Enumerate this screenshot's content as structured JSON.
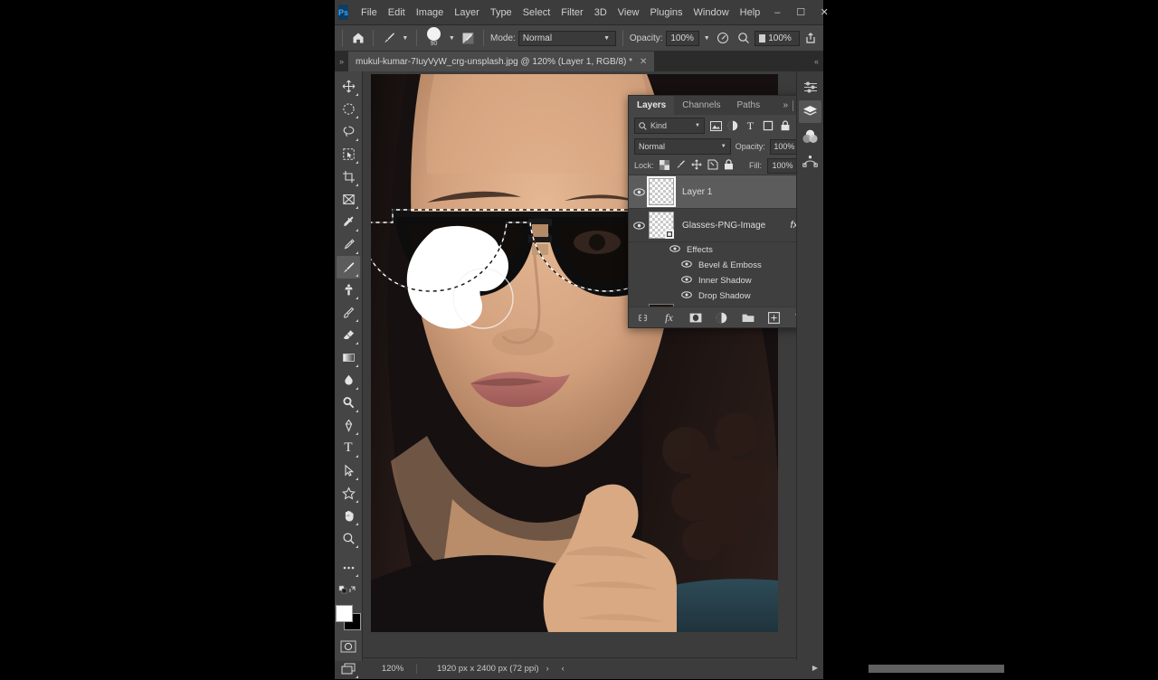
{
  "app": {
    "name": "Adobe Photoshop",
    "logo_text": "Ps"
  },
  "menubar": {
    "items": [
      "File",
      "Edit",
      "Image",
      "Layer",
      "Type",
      "Select",
      "Filter",
      "3D",
      "View",
      "Plugins",
      "Window",
      "Help"
    ],
    "window_controls": [
      "minimize",
      "maximize",
      "close"
    ]
  },
  "options_bar": {
    "home_icon": "home-icon",
    "brush_tool_icon": "brush-icon",
    "brush_size": "90",
    "brush_settings_icon": "brush-panel-icon",
    "mode_label": "Mode:",
    "mode_value": "Normal",
    "opacity_label": "Opacity:",
    "opacity_value": "100%",
    "airbrush_icon": "airbrush-icon",
    "flow_icon": "flow-icon",
    "smoothing_value": "100%",
    "share_icon": "share-icon"
  },
  "tab_bar": {
    "expand_icon": "chevron-double-right-icon",
    "collapse_icon": "chevron-double-left-icon",
    "document_title": "mukul-kumar-7IuyVyW_crg-unsplash.jpg @ 120% (Layer 1, RGB/8) *",
    "close_icon": "close-icon"
  },
  "toolbar": {
    "tools": [
      {
        "name": "move-tool",
        "selected": false
      },
      {
        "name": "marquee-tool",
        "selected": false
      },
      {
        "name": "lasso-tool",
        "selected": false
      },
      {
        "name": "quick-selection-tool",
        "selected": false
      },
      {
        "name": "crop-tool",
        "selected": false
      },
      {
        "name": "frame-tool",
        "selected": false
      },
      {
        "name": "eyedropper-tool",
        "selected": false
      },
      {
        "name": "healing-brush-tool",
        "selected": false
      },
      {
        "name": "brush-tool",
        "selected": true
      },
      {
        "name": "clone-stamp-tool",
        "selected": false
      },
      {
        "name": "history-brush-tool",
        "selected": false
      },
      {
        "name": "eraser-tool",
        "selected": false
      },
      {
        "name": "gradient-tool",
        "selected": false
      },
      {
        "name": "blur-tool",
        "selected": false
      },
      {
        "name": "dodge-tool",
        "selected": false
      },
      {
        "name": "pen-tool",
        "selected": false
      },
      {
        "name": "type-tool",
        "selected": false
      },
      {
        "name": "path-selection-tool",
        "selected": false
      },
      {
        "name": "shape-tool",
        "selected": false
      },
      {
        "name": "hand-tool",
        "selected": false
      },
      {
        "name": "zoom-tool",
        "selected": false
      },
      {
        "name": "edit-toolbar-tool",
        "selected": false
      }
    ],
    "foreground_color": "#ffffff",
    "background_color": "#000000",
    "quick_mask_icon": "quick-mask-icon",
    "screen_mode_icon": "screen-mode-icon"
  },
  "layers_panel": {
    "tabs": [
      {
        "label": "Layers",
        "active": true
      },
      {
        "label": "Channels",
        "active": false
      },
      {
        "label": "Paths",
        "active": false
      }
    ],
    "panel_menu_icon": "panel-menu-icon",
    "filter": {
      "search_icon": "search-icon",
      "kind_label": "Kind",
      "filter_icons": [
        "pixel-filter-icon",
        "adjustment-filter-icon",
        "type-filter-icon",
        "shape-filter-icon",
        "smart-object-filter-icon"
      ],
      "toggle_icon": "filter-toggle-icon"
    },
    "blend_mode": "Normal",
    "opacity_label": "Opacity:",
    "opacity_value": "100%",
    "lock_label": "Lock:",
    "lock_icons": [
      "lock-transparent-icon",
      "lock-image-icon",
      "lock-position-icon",
      "lock-artboard-icon",
      "lock-all-icon"
    ],
    "fill_label": "Fill:",
    "fill_value": "100%",
    "layers": [
      {
        "name": "Layer 1",
        "visible": true,
        "selected": true,
        "has_effects": false,
        "thumb": "transparent"
      },
      {
        "name": "Glasses-PNG-Image",
        "visible": true,
        "selected": false,
        "has_effects": true,
        "fx_label": "fx",
        "thumb": "transparent",
        "effects_group": "Effects",
        "effects": [
          "Bevel & Emboss",
          "Inner Shadow",
          "Drop Shadow"
        ]
      },
      {
        "name": "",
        "visible": true,
        "selected": false,
        "has_effects": false,
        "thumb": "photo"
      }
    ],
    "footer_buttons": [
      "link-layers-icon",
      "layer-style-icon",
      "layer-mask-icon",
      "adjustment-layer-icon",
      "new-group-icon",
      "new-layer-icon",
      "delete-layer-icon"
    ]
  },
  "right_dock": {
    "items": [
      {
        "name": "adjustments-panel-icon",
        "active": false
      },
      {
        "name": "layers-panel-icon",
        "active": true
      },
      {
        "name": "color-panel-icon",
        "active": false
      },
      {
        "name": "paths-panel-icon",
        "active": false
      }
    ]
  },
  "status_bar": {
    "zoom": "120%",
    "document_size": "1920 px x 2400 px (72 ppi)",
    "next_icon": "chevron-right-icon",
    "prev_icon": "chevron-left-icon"
  },
  "canvas": {
    "image_description": "portrait-of-woman-with-sunglasses",
    "selection_active": true,
    "paint_strokes": [
      "white-brush-blob",
      "white-circle"
    ]
  }
}
